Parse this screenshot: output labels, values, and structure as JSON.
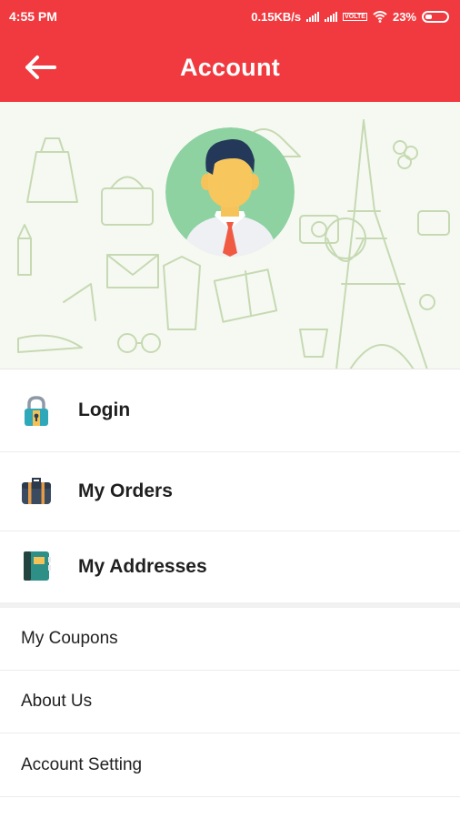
{
  "status_bar": {
    "time": "4:55 PM",
    "network_speed": "0.15KB/s",
    "volte": "VOLTE",
    "battery": "23%"
  },
  "app_bar": {
    "title": "Account",
    "back_icon": "arrow-left-icon",
    "color": "#f03a3f"
  },
  "header": {
    "avatar_icon": "user-avatar-icon"
  },
  "menu": {
    "login": {
      "label": "Login",
      "icon": "padlock-icon"
    },
    "orders": {
      "label": "My Orders",
      "icon": "briefcase-icon"
    },
    "addresses": {
      "label": "My Addresses",
      "icon": "address-book-icon"
    }
  },
  "links": {
    "coupons": "My Coupons",
    "about": "About Us",
    "settings": "Account Setting"
  }
}
